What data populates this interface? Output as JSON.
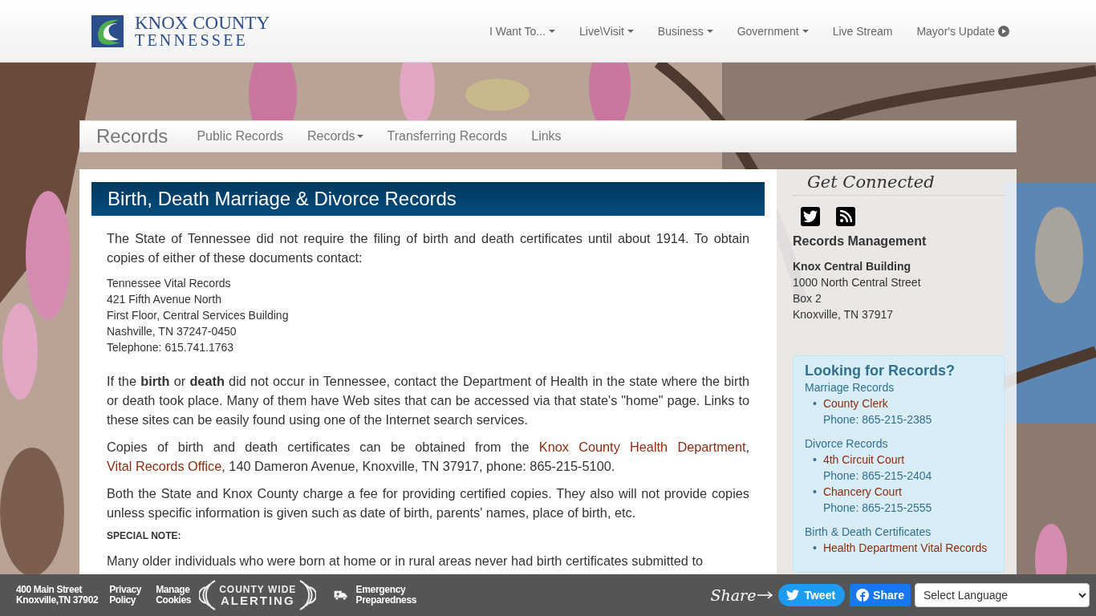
{
  "logo": {
    "line1": "KNOX COUNTY",
    "line2": "TENNESSEE"
  },
  "nav": [
    {
      "label": "I Want To...",
      "kind": "dropdown"
    },
    {
      "label": "Live\\Visit",
      "kind": "dropdown"
    },
    {
      "label": "Business",
      "kind": "dropdown"
    },
    {
      "label": "Government",
      "kind": "dropdown"
    },
    {
      "label": "Live Stream",
      "kind": "link"
    },
    {
      "label": "Mayor's Update",
      "kind": "play"
    }
  ],
  "subnav": {
    "title": "Records",
    "items": [
      {
        "label": "Public Records",
        "kind": "link"
      },
      {
        "label": "Records",
        "kind": "dropdown"
      },
      {
        "label": "Transferring Records",
        "kind": "link"
      },
      {
        "label": "Links",
        "kind": "link"
      }
    ]
  },
  "content": {
    "heading": "Birth, Death Marriage & Divorce Records",
    "blocks": [
      {
        "kind": "paragraph",
        "segments": [
          {
            "text": "The State of Tennessee did not require the filing of birth and death certificates until about 1914. To obtain copies of either of these documents contact:",
            "kind": "text"
          }
        ]
      },
      {
        "kind": "address",
        "lines": [
          "Tennessee Vital Records",
          "421 Fifth Avenue North",
          "First Floor, Central Services Building",
          "Nashville, TN 37247-0450",
          "Telephone: 615.741.1763"
        ]
      },
      {
        "kind": "paragraph",
        "segments": [
          {
            "text": "If the **birth** or **death** did not occur in Tennessee, contact the Department of Health in the state where the birth or death took place. Many of them have Web sites that can be accessed via that state's \"home\" page. Links to these sites can be easily found using one of the Internet search services.",
            "kind": "text"
          }
        ]
      },
      {
        "kind": "paragraph",
        "segments": [
          {
            "text": "Copies of birth and death certificates can be obtained from the ",
            "kind": "text"
          },
          {
            "text": "Knox County Health Department",
            "kind": "link"
          },
          {
            "text": ", ",
            "kind": "text"
          },
          {
            "text": "Vital Records Office",
            "kind": "link"
          },
          {
            "text": ", 140 Dameron Avenue, Knoxville, TN 37917, phone: 865-215-5100.",
            "kind": "text"
          }
        ]
      },
      {
        "kind": "paragraph",
        "segments": [
          {
            "text": "Both the State and Knox County charge a fee for providing certified copies. They also will not provide copies unless specific information is given such as date of birth, parents' names, place of birth, etc.",
            "kind": "text"
          }
        ]
      },
      {
        "kind": "note",
        "text": "SPECIAL NOTE:"
      },
      {
        "kind": "paragraph",
        "segments": [
          {
            "text": "Many older individuals who were born at home or in rural areas never had birth certificates submitted to",
            "kind": "text"
          }
        ]
      }
    ]
  },
  "sidebar": {
    "title": "Get Connected",
    "social": [
      {
        "kind": "twitter"
      },
      {
        "kind": "rss"
      }
    ],
    "office": {
      "title": "Records Management",
      "building": "Knox Central Building",
      "lines": [
        "1000 North Central Street",
        "Box 2",
        "Knoxville, TN 37917"
      ]
    },
    "records": {
      "title": "Looking for Records?",
      "marker": "•",
      "groups": [
        {
          "title": "Marriage Records",
          "items": [
            {
              "name": "County Clerk",
              "phone": "Phone: 865-215-2385"
            }
          ]
        },
        {
          "title": "Divorce Records",
          "items": [
            {
              "name": "4th Circuit Court",
              "phone": "Phone: 865-215-2404"
            },
            {
              "name": "Chancery Court",
              "phone": "Phone: 865-215-2555"
            }
          ]
        },
        {
          "title": "Birth & Death Certificates",
          "items": [
            {
              "name": "Health Department Vital Records"
            }
          ]
        }
      ]
    }
  },
  "footer": {
    "address": [
      "400 Main Street",
      "Knoxville,TN 37902"
    ],
    "links": [
      "Privacy Policy",
      "Manage Cookies"
    ],
    "alerting": [
      "COUNTY WIDE",
      "ALERTING"
    ],
    "emergency": "Emergency Preparedness",
    "share_label": "Share",
    "tweet": "Tweet",
    "facebook": "Share",
    "language": {
      "placeholder": "Select Language"
    }
  }
}
